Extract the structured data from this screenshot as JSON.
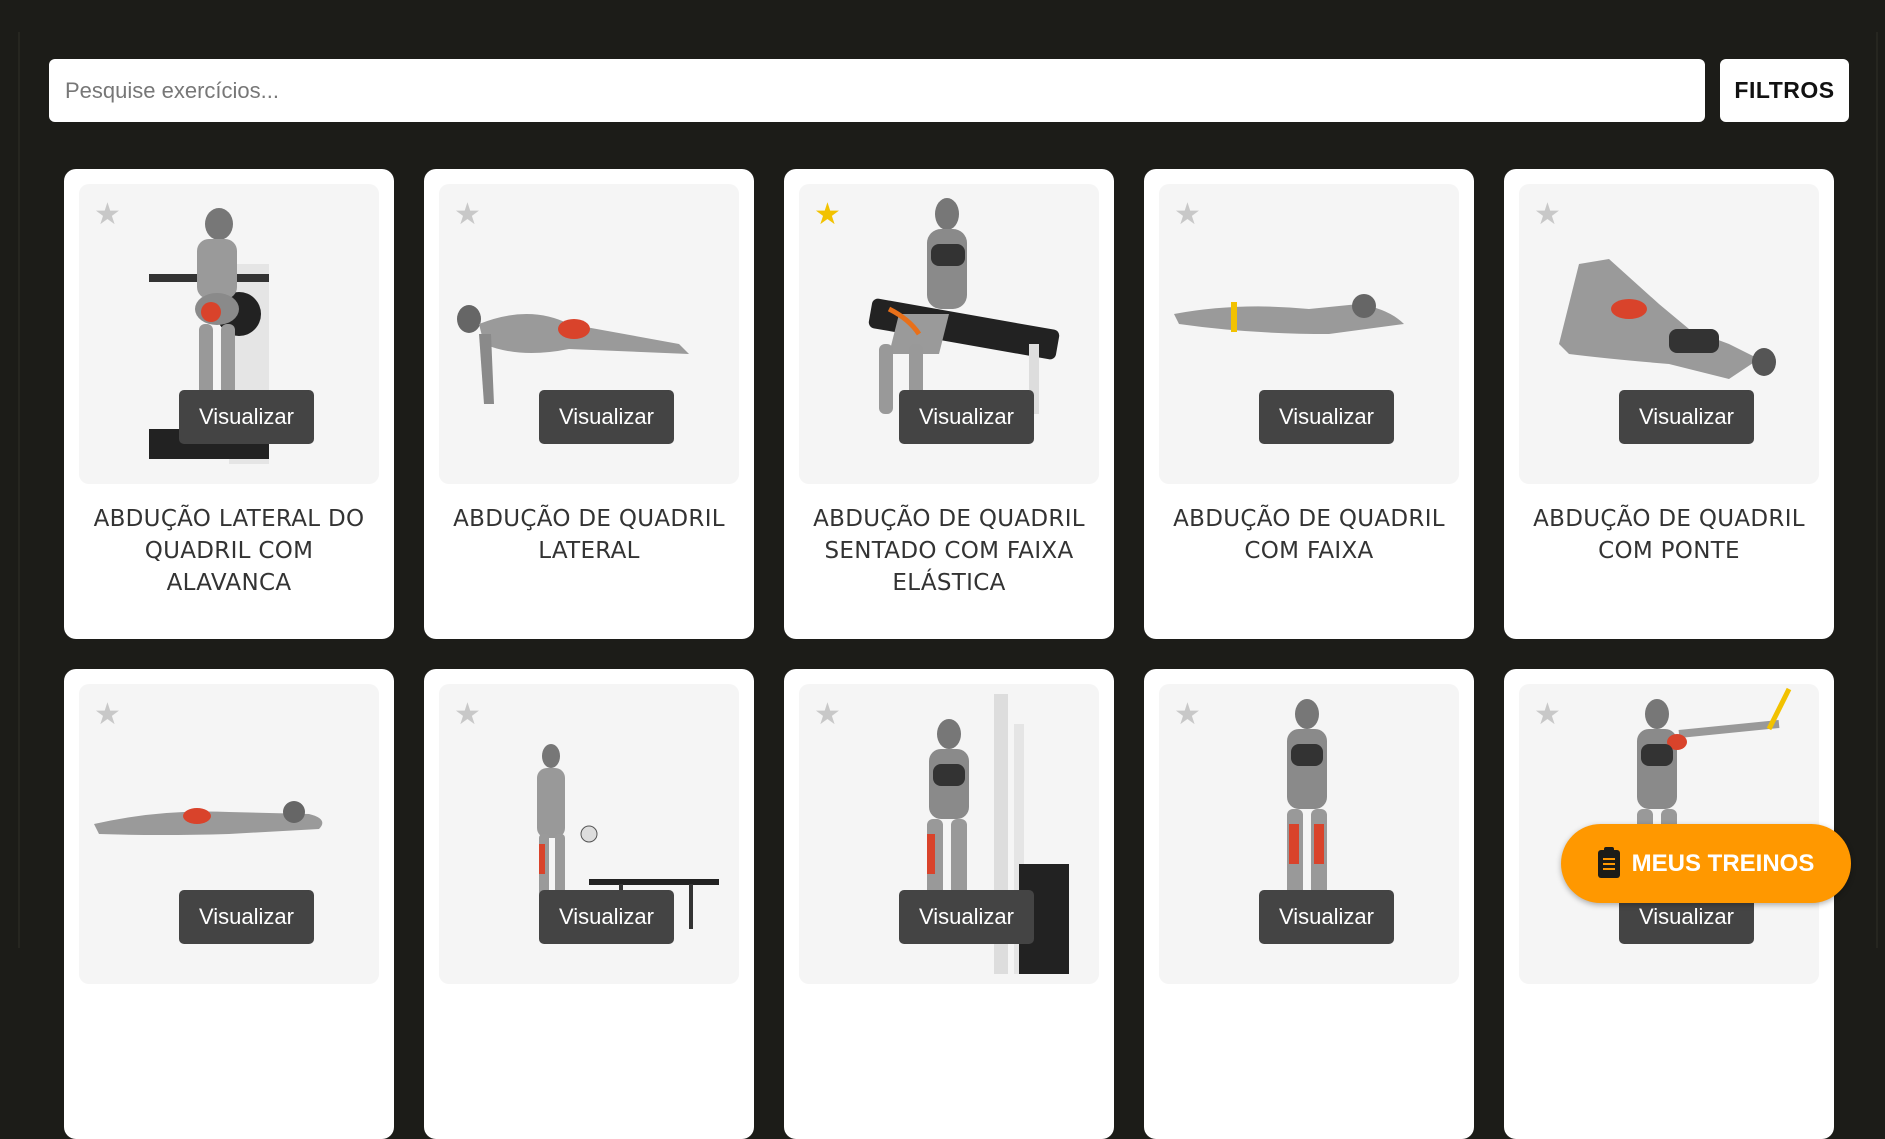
{
  "search": {
    "placeholder": "Pesquise exercícios...",
    "value": ""
  },
  "filters_label": "FILTROS",
  "view_label": "Visualizar",
  "fab": {
    "label": "MEUS TREINOS",
    "icon": "clipboard-icon",
    "color": "#ff9800"
  },
  "exercises": [
    {
      "title": "ABDUÇÃO LATERAL DO QUADRIL COM ALAVANCA",
      "favorite": false
    },
    {
      "title": "ABDUÇÃO DE QUADRIL LATERAL",
      "favorite": false
    },
    {
      "title": "ABDUÇÃO DE QUADRIL SENTADO COM FAIXA ELÁSTICA",
      "favorite": true
    },
    {
      "title": "ABDUÇÃO DE QUADRIL COM FAIXA",
      "favorite": false
    },
    {
      "title": "ABDUÇÃO DE QUADRIL COM PONTE",
      "favorite": false
    },
    {
      "title": "",
      "favorite": false
    },
    {
      "title": "",
      "favorite": false
    },
    {
      "title": "",
      "favorite": false
    },
    {
      "title": "",
      "favorite": false
    },
    {
      "title": "",
      "favorite": false
    }
  ],
  "colors": {
    "background": "#1c1c18",
    "card": "#ffffff",
    "star_off": "#c8c8c8",
    "star_on": "#f2c200",
    "view_button": "#444444",
    "muscle_highlight": "#d9432b"
  }
}
